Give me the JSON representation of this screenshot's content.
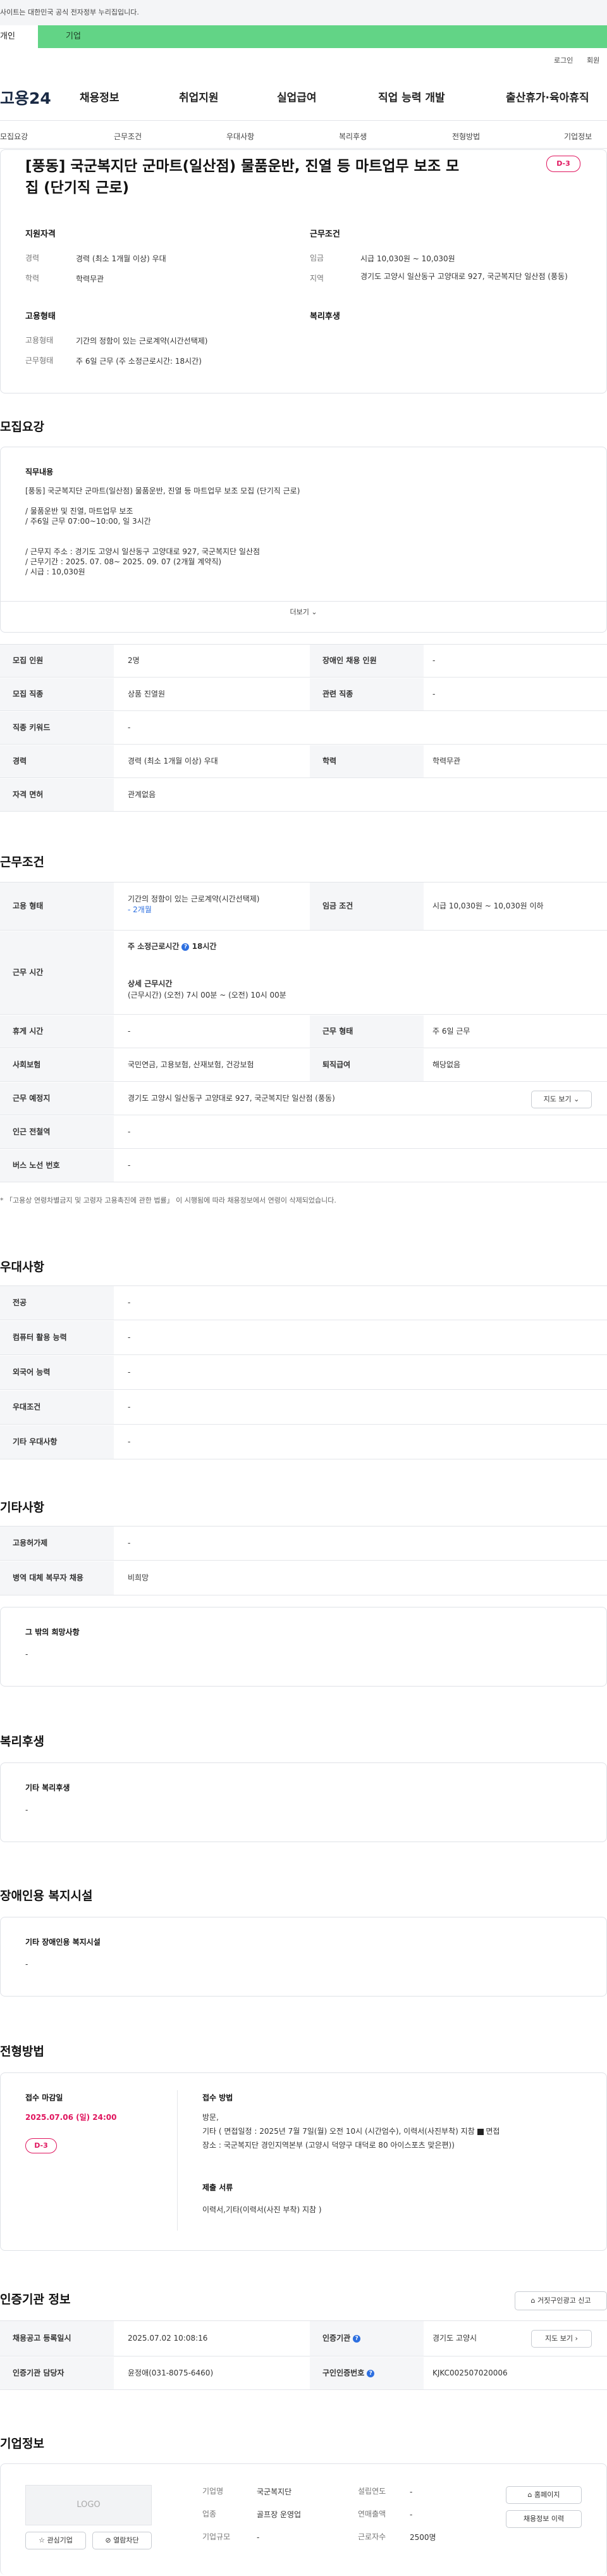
{
  "gov_banner": {
    "text": "사이트는 대한민국 공식 전자정부 누리집입니다."
  },
  "tabs": {
    "personal": "개인",
    "company": "기업"
  },
  "util": {
    "login": "로그인",
    "join": "회원"
  },
  "logo": "고용24",
  "gnb": [
    "채용정보",
    "취업지원",
    "실업급여",
    "직업 능력 개발",
    "출산휴가·육아휴직"
  ],
  "snb": [
    "모집요강",
    "근무조건",
    "우대사항",
    "복리후생",
    "전형방법",
    "기업정보"
  ],
  "summary": {
    "title": "[풍동] 국군복지단 군마트(일산점) 물품운반, 진열 등 마트업무 보조 모집 (단기직 근로)",
    "dday": "D-3",
    "qual_head": "지원자격",
    "career_lbl": "경력",
    "career": "경력 (최소 1개월 이상) 우대",
    "edu_lbl": "학력",
    "edu": "학력무관",
    "work_head": "근무조건",
    "wage_lbl": "임금",
    "wage": "시급 10,030원 ~ 10,030원",
    "region_lbl": "지역",
    "region": "경기도 고양시 일산동구 고양대로 927, 국군복지단 일산점 (풍동)",
    "emp_head": "고용형태",
    "emp_lbl": "고용형태",
    "emp": "기간의 정함이 있는 근로계약(시간선택제)",
    "form_lbl": "근무형태",
    "form": "주 6일 근무 (주 소정근로시간: 18시간)",
    "welfare_head": "복리후생"
  },
  "recruit": {
    "heading": "모집요강",
    "duty_head": "직무내용",
    "duty_lines": [
      "[풍동] 국군복지단 군마트(일산점) 물품운반, 진열 등 마트업무 보조 모집 (단기직 근로)",
      "",
      "/ 물품운반 및 진열, 마트업무 보조",
      "/ 주6일 근무 07:00~10:00, 일 3시간",
      "",
      "",
      "/ 근무지 주소 : 경기도 고양시 일산동구 고양대로 927, 국군복지단 일산점",
      "/ 근무기간 : 2025. 07. 08~ 2025. 09. 07 (2개월 계약직)",
      "/ 시급 : 10,030원"
    ],
    "more": "더보기",
    "r1": {
      "l1": "모집 인원",
      "v1": "2명",
      "l2": "장애인 채용 인원",
      "v2": "-"
    },
    "r2": {
      "l1": "모집 직종",
      "v1": "상품 진열원",
      "l2": "관련 직종",
      "v2": "-"
    },
    "r3": {
      "l1": "직종 키워드",
      "v1": "-"
    },
    "r4": {
      "l1": "경력",
      "v1": "경력 (최소 1개월 이상) 우대",
      "l2": "학력",
      "v2": "학력무관"
    },
    "r5": {
      "l1": "자격 면허",
      "v1": "관계없음"
    }
  },
  "conditions": {
    "heading": "근무조건",
    "emp_lbl": "고용 형태",
    "emp1": "기간의 정함이 있는 근로계약(시간선택제)",
    "emp2": "- 2개월",
    "wage_lbl": "임금 조건",
    "wage": "시급 10,030원 ~ 10,030원 이하",
    "hours_lbl": "근무 시간",
    "hours1": "주 소정근로시간",
    "hours1b": "18시간",
    "hours2": "상세 근무시간",
    "hours3": "(근무시간) (오전) 7시 00분 ~ (오전) 10시 00분",
    "rest_lbl": "휴게 시간",
    "rest": "-",
    "form_lbl": "근무 형태",
    "form": "주 6일 근무",
    "ins_lbl": "사회보험",
    "ins": "국민연금, 고용보험, 산재보험, 건강보험",
    "sev_lbl": "퇴직급여",
    "sev": "해당없음",
    "place_lbl": "근무 예정지",
    "place": "경기도 고양시 일산동구 고양대로 927, 국군복지단 일산점 (풍동)",
    "map": "지도 보기",
    "subway_lbl": "인근 전철역",
    "subway": "-",
    "bus_lbl": "버스 노선 번호",
    "bus": "-",
    "note": "* 「고용상 연령차별금지 및 고령자 고용촉진에 관한 법률」 이 시행됨에 따라 채용정보에서 연령이 삭제되었습니다."
  },
  "preference": {
    "heading": "우대사항",
    "rows": [
      {
        "l": "전공",
        "v": "-"
      },
      {
        "l": "컴퓨터 활용 능력",
        "v": "-"
      },
      {
        "l": "외국어 능력",
        "v": "-"
      },
      {
        "l": "우대조건",
        "v": "-"
      },
      {
        "l": "기타 우대사항",
        "v": "-"
      }
    ]
  },
  "etc": {
    "heading": "기타사항",
    "r1": {
      "l": "고용허가제",
      "v": "-"
    },
    "r2": {
      "l": "병역 대체 복무자 채용",
      "v": "비희망"
    },
    "other_head": "그 밖의 희망사항",
    "other": "-"
  },
  "welfare": {
    "heading": "복리후생",
    "head": "기타 복리후생",
    "val": "-"
  },
  "disabled": {
    "heading": "장애인용 복지시설",
    "head": "기타 장애인용 복지시설",
    "val": "-"
  },
  "process": {
    "heading": "전형방법",
    "deadline_head": "접수 마감일",
    "deadline": "2025.07.06 (일) 24:00",
    "dday": "D-3",
    "method_head": "접수 방법",
    "method1": "방문,",
    "method2": "기타 ( 면접일정 : 2025년 7월 7일(월) 오전 10시 (시간엄수), 이력서(사진부착) 지참",
    "method2b": "면접",
    "method3": "장소 : 국군복지단 경인지역본부 (고양시 덕양구 대덕로 80 아이스포츠 맞은편))",
    "docs_head": "제출 서류",
    "docs": "이력서,기타(이력서(사진 부착) 지참 )"
  },
  "agency": {
    "heading": "인증기관 정보",
    "report": "거짓구인광고 신고",
    "reg_lbl": "채용공고 등록일시",
    "reg": "2025.07.02 10:08:16",
    "org_lbl": "인증기관",
    "org": "경기도 고양시",
    "map": "지도 보기",
    "mgr_lbl": "인증기관 담당자",
    "mgr": "윤정애(031-8075-6460)",
    "num_lbl": "구인인증번호",
    "num": "KJKC002507020006"
  },
  "company": {
    "heading": "기업정보",
    "logo": "LOGO",
    "fav": "관심기업",
    "follow": "열람차단",
    "name_lbl": "기업명",
    "name": "국군복지단",
    "year_lbl": "설립연도",
    "year": "-",
    "ind_lbl": "업종",
    "ind": "골프장 운영업",
    "sales_lbl": "연매출액",
    "sales": "-",
    "size_lbl": "기업규모",
    "size": "-",
    "emp_lbl": "근로자수",
    "emp": "2500명",
    "home": "홈페이지",
    "jobs": "채용정보 이력"
  }
}
